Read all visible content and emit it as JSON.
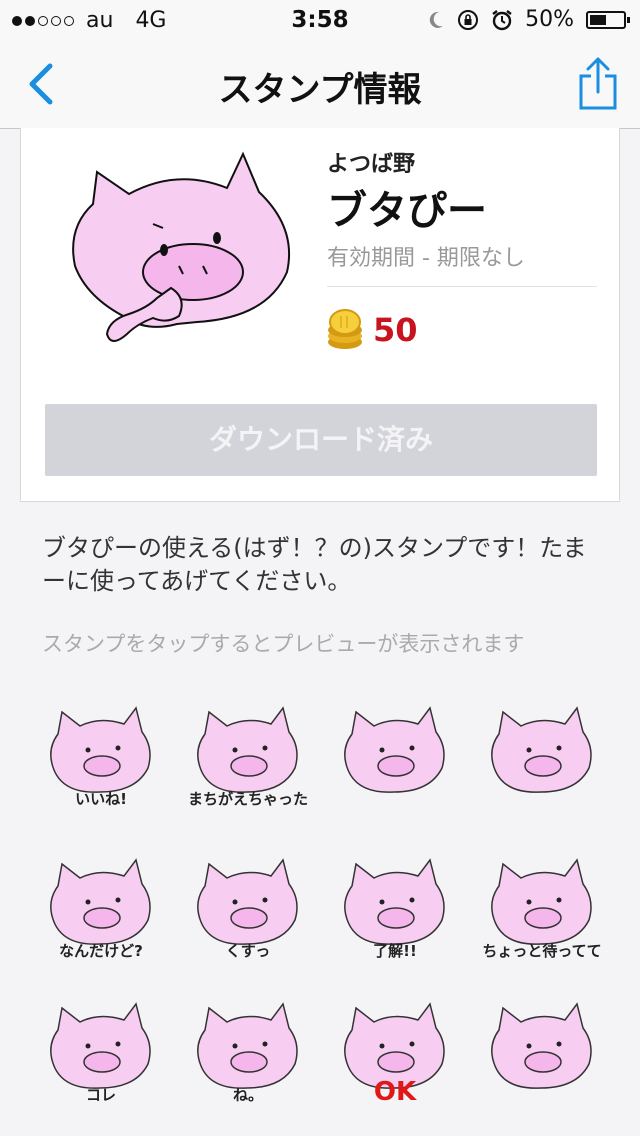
{
  "status": {
    "carrier": "au",
    "network": "4G",
    "time": "3:58",
    "battery": "50%",
    "battery_level": 0.5,
    "signal_bars_filled": 2,
    "signal_bars_total": 5
  },
  "nav": {
    "title": "スタンプ情報",
    "back_icon": "chevron-left-icon",
    "share_icon": "share-icon",
    "accent": "#1a8ee1"
  },
  "product": {
    "author": "よつば野",
    "name": "ブタぴー",
    "validity": "有効期間 - 期限なし",
    "price": "50",
    "coin_icon": "coin-stack-icon",
    "download_label": "ダウンロード済み"
  },
  "description": "ブタぴーの使える(はず！？の)スタンプです！たまーに使ってあげてください。",
  "preview_hint": "スタンプをタップするとプレビューが表示されます",
  "stamps": [
    {
      "caption": "いいね!"
    },
    {
      "caption": "まちがえちゃった"
    },
    {
      "caption": ""
    },
    {
      "caption": ""
    },
    {
      "caption": "なんだけど?"
    },
    {
      "caption": "くすっ"
    },
    {
      "caption": "了解!!"
    },
    {
      "caption": "ちょっと待ってて"
    },
    {
      "caption": "コレ"
    },
    {
      "caption": "ね。"
    },
    {
      "caption": "OK"
    },
    {
      "caption": ""
    }
  ]
}
